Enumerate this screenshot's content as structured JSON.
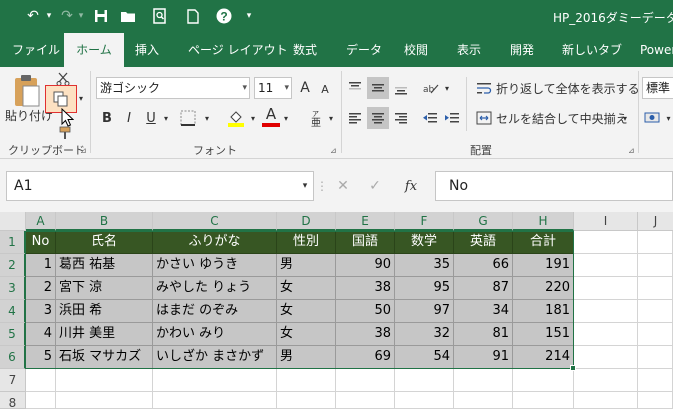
{
  "titlebar": {
    "title": "HP_2016ダミーデータ_成"
  },
  "tabs": [
    {
      "label": "ファイル"
    },
    {
      "label": "ホーム"
    },
    {
      "label": "挿入"
    },
    {
      "label": "ページ レイアウト"
    },
    {
      "label": "数式"
    },
    {
      "label": "データ"
    },
    {
      "label": "校閲"
    },
    {
      "label": "表示"
    },
    {
      "label": "開発"
    },
    {
      "label": "新しいタブ"
    },
    {
      "label": "Power"
    }
  ],
  "ribbon": {
    "clipboard": {
      "paste_label": "貼り付け",
      "group_label": "クリップボード"
    },
    "font": {
      "font_name": "游ゴシック",
      "font_size": "11",
      "grow": "A",
      "shrink": "A",
      "bold": "B",
      "italic": "I",
      "underline": "U",
      "font_color_glyph": "A",
      "group_label": "フォント"
    },
    "alignment": {
      "wrap_text_label": "折り返して全体を表示する",
      "merge_center_label": "セルを結合して中央揃え",
      "group_label": "配置"
    },
    "number": {
      "format_label": "標準"
    }
  },
  "formula_bar": {
    "name_box": "A1",
    "fx_label": "fx",
    "formula": "No"
  },
  "grid": {
    "columns": [
      "A",
      "B",
      "C",
      "D",
      "E",
      "F",
      "G",
      "H",
      "I",
      "J"
    ],
    "rows": [
      "1",
      "2",
      "3",
      "4",
      "5",
      "6",
      "7",
      "8"
    ],
    "header": [
      "No",
      "氏名",
      "ふりがな",
      "性別",
      "国語",
      "数学",
      "英語",
      "合計"
    ],
    "data": [
      [
        "1",
        "葛西 祐基",
        "かさい ゆうき",
        "男",
        "90",
        "35",
        "66",
        "191"
      ],
      [
        "2",
        "宮下 涼",
        "みやした りょう",
        "女",
        "38",
        "95",
        "87",
        "220"
      ],
      [
        "3",
        "浜田 希",
        "はまだ のぞみ",
        "女",
        "50",
        "97",
        "34",
        "181"
      ],
      [
        "4",
        "川井 美里",
        "かわい みり",
        "女",
        "38",
        "32",
        "81",
        "151"
      ],
      [
        "5",
        "石坂 マサカズ",
        "いしざか まさかず",
        "男",
        "69",
        "54",
        "91",
        "214"
      ]
    ]
  },
  "colors": {
    "excel_green": "#217346",
    "header_fill": "#375623",
    "body_fill": "#c6c6c6",
    "highlight_red": "#e03030"
  }
}
